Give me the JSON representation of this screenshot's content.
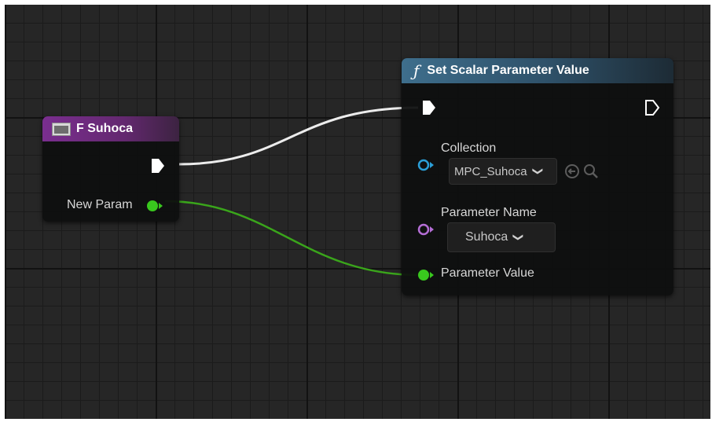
{
  "var_node": {
    "title": "F Suhoca",
    "output_pin_label": "New Param",
    "icon": "variable-icon",
    "header_color": "#7a2e8f",
    "pin_color": "#39c81e"
  },
  "func_node": {
    "title": "Set Scalar Parameter Value",
    "icon": "function-icon",
    "header_color": "#3e6e8c",
    "collection": {
      "label": "Collection",
      "value": "MPC_Suhoca",
      "pin_color": "#2b9fd8"
    },
    "parameter_name": {
      "label": "Parameter Name",
      "value": "Suhoca",
      "pin_color": "#b56ed6"
    },
    "parameter_value": {
      "label": "Parameter Value",
      "pin_color": "#39c81e"
    }
  },
  "wires": {
    "exec_color": "#ececec",
    "float_color": "#3aa51b"
  }
}
